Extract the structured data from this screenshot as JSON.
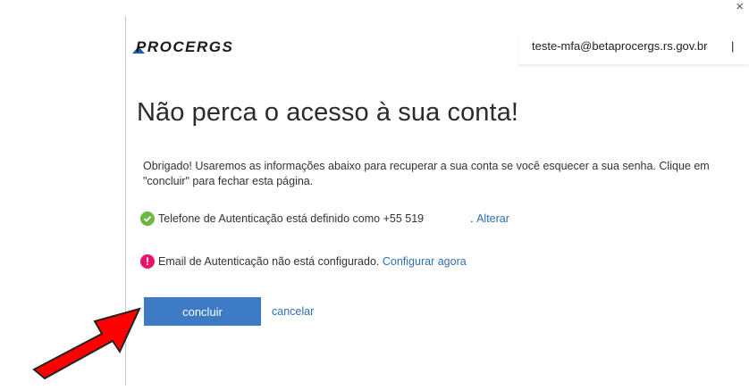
{
  "window": {
    "close_glyph": "×"
  },
  "header": {
    "logo_text": "PROCERGS",
    "user_email": "teste-mfa@betaprocergs.rs.gov.br",
    "separator": "|"
  },
  "main": {
    "title": "Não perca o acesso à sua conta!",
    "description": "Obrigado! Usaremos as informações abaixo para recuperar a sua conta se você esquecer a sua senha. Clique em \"concluir\" para fechar esta página.",
    "phone": {
      "status_icon": "check-circle-icon",
      "text": "Telefone de Autenticação está definido como +55 519",
      "masked": "",
      "separator": ".",
      "link": "Alterar"
    },
    "email": {
      "status_icon": "exclamation-circle-icon",
      "text": "Email de Autenticação não está configurado.",
      "link": "Configurar agora"
    },
    "actions": {
      "primary": "concluir",
      "secondary": "cancelar"
    }
  },
  "colors": {
    "accent": "#3d7bc4",
    "link": "#2f6fb3",
    "ok": "#6bb842",
    "warn": "#e8136b",
    "arrow": "#e00000"
  }
}
